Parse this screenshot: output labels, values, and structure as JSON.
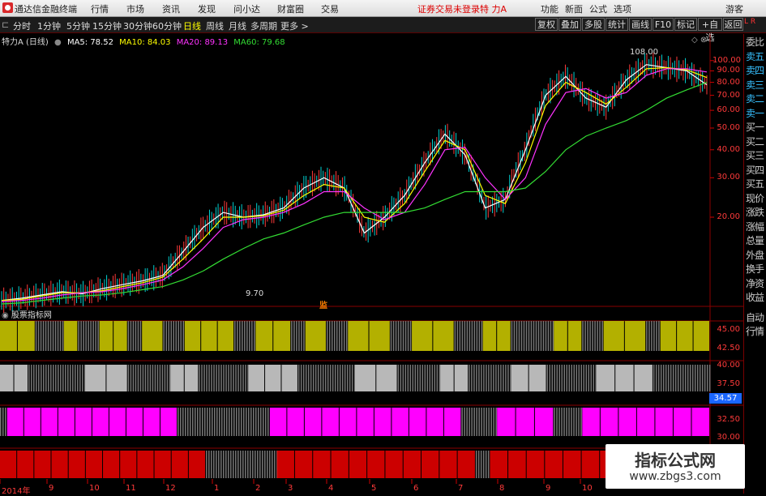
{
  "window": {
    "app_title": "通达信金融终端",
    "menus": [
      "行情",
      "市场",
      "资讯",
      "发现",
      "问小达",
      "财富圈",
      "交易"
    ],
    "notice": "证券交易未登录",
    "stock": "特 力A",
    "right_menus": [
      "功能",
      "新面",
      "公式",
      "选项"
    ],
    "user": "游客"
  },
  "toolbar": {
    "periods": [
      "分时",
      "1分钟",
      "5分钟",
      "15分钟",
      "30分钟",
      "60分钟",
      "日线",
      "周线",
      "月线",
      "多周期",
      "更多 >"
    ],
    "active": "日线",
    "right_buttons": [
      "复权",
      "叠加",
      "多股",
      "统计",
      "画线",
      "F10",
      "标记",
      "+自选",
      "返回"
    ]
  },
  "legend": {
    "name": "特力A (日线)",
    "ma5": "MA5: 78.52",
    "ma10": "MA10: 84.03",
    "ma20": "MA20: 89.13",
    "ma60": "MA60: 79.68",
    "colors": {
      "ma5": "#ffffff",
      "ma10": "#ffff00",
      "ma20": "#ff33ff",
      "ma60": "#33dd33"
    }
  },
  "price_annotations": {
    "high": "108.00",
    "low": "9.70",
    "marker": "监"
  },
  "side_panel": {
    "corner": "L R",
    "items": [
      "委比",
      "卖五",
      "卖四",
      "卖三",
      "卖二",
      "卖一",
      "买一",
      "买二",
      "买三",
      "买四",
      "买五",
      "现价",
      "涨跌",
      "涨幅",
      "总量",
      "外盘",
      "换手",
      "净资",
      "收益"
    ],
    "bottom_items": [
      "自动",
      "行情"
    ]
  },
  "indicator": {
    "title": "股票指标网",
    "value_badge": "34.57"
  },
  "watermark": {
    "line1": "指标公式网",
    "line2": "www.zbgs3.com"
  },
  "x_axis_labels": [
    "2014年",
    "9",
    "10",
    "11",
    "12",
    "1",
    "2",
    "3",
    "4",
    "5",
    "6",
    "7",
    "8",
    "9",
    "10"
  ],
  "chart_data": {
    "type": "line",
    "main_axis": {
      "scale": "log",
      "ticks": [
        100.0,
        90.0,
        80.0,
        70.0,
        60.0,
        50.0,
        40.0,
        30.0,
        20.0
      ]
    },
    "series": [
      {
        "name": "MA5",
        "values": [
          8.5,
          8.7,
          9.0,
          9.3,
          9.1,
          9.6,
          10,
          10.4,
          11,
          14,
          18,
          21,
          20,
          20.5,
          22,
          27,
          30,
          27,
          17,
          20,
          25,
          35,
          47,
          38,
          22,
          24,
          40,
          70,
          85,
          68,
          62,
          82,
          96,
          93,
          90,
          78
        ]
      },
      {
        "name": "MA10",
        "values": [
          8.5,
          8.6,
          8.9,
          9.2,
          9.2,
          9.4,
          9.8,
          10.2,
          10.8,
          13,
          16,
          20,
          20,
          20.3,
          21.5,
          25,
          28,
          27,
          20,
          19,
          23,
          32,
          44,
          40,
          25,
          23,
          35,
          63,
          80,
          72,
          64,
          76,
          92,
          93,
          91,
          84
        ]
      },
      {
        "name": "MA20",
        "values": [
          8.4,
          8.5,
          8.7,
          9.0,
          9.2,
          9.3,
          9.6,
          10,
          10.5,
          12,
          14.5,
          18,
          19.5,
          20,
          21,
          23,
          26,
          26,
          22,
          19.5,
          21,
          28,
          40,
          41,
          30,
          24,
          30,
          52,
          72,
          75,
          68,
          72,
          86,
          92,
          92,
          89
        ]
      },
      {
        "name": "MA60",
        "values": [
          8.2,
          8.3,
          8.5,
          8.7,
          8.9,
          9.0,
          9.2,
          9.5,
          9.8,
          10.5,
          11.5,
          13,
          14.5,
          16,
          17,
          18.5,
          20,
          21,
          21,
          21,
          21,
          22,
          24,
          26,
          26,
          26,
          27,
          32,
          40,
          46,
          50,
          54,
          60,
          68,
          74,
          80
        ]
      }
    ],
    "indicator_axes": [
      {
        "ticks": [
          45.0,
          42.5
        ]
      },
      {
        "ticks": [
          40.0,
          37.5
        ]
      },
      {
        "ticks": [
          32.5,
          30.0
        ]
      }
    ],
    "bands": [
      {
        "color": "#b3b000",
        "segments": [
          [
            0,
            0.05,
            1
          ],
          [
            0.05,
            0.09,
            0
          ],
          [
            0.09,
            0.11,
            1
          ],
          [
            0.11,
            0.14,
            0
          ],
          [
            0.14,
            0.18,
            1
          ],
          [
            0.18,
            0.2,
            0
          ],
          [
            0.2,
            0.23,
            1
          ],
          [
            0.23,
            0.26,
            0
          ],
          [
            0.26,
            0.33,
            1
          ],
          [
            0.33,
            0.36,
            0
          ],
          [
            0.36,
            0.41,
            1
          ],
          [
            0.41,
            0.43,
            0
          ],
          [
            0.43,
            0.46,
            1
          ],
          [
            0.46,
            0.49,
            0
          ],
          [
            0.49,
            0.55,
            1
          ],
          [
            0.55,
            0.58,
            0
          ],
          [
            0.58,
            0.64,
            1
          ],
          [
            0.64,
            0.68,
            0
          ],
          [
            0.68,
            0.72,
            1
          ],
          [
            0.72,
            0.78,
            0
          ],
          [
            0.78,
            0.82,
            1
          ],
          [
            0.82,
            0.85,
            0
          ],
          [
            0.85,
            0.91,
            1
          ],
          [
            0.91,
            0.93,
            0
          ],
          [
            0.93,
            1,
            1
          ]
        ]
      },
      {
        "color": "#b8b8b8",
        "segments": [
          [
            0,
            0.04,
            1
          ],
          [
            0.04,
            0.12,
            0
          ],
          [
            0.12,
            0.18,
            1
          ],
          [
            0.18,
            0.24,
            0
          ],
          [
            0.24,
            0.28,
            1
          ],
          [
            0.28,
            0.35,
            0
          ],
          [
            0.35,
            0.42,
            1
          ],
          [
            0.42,
            0.5,
            0
          ],
          [
            0.5,
            0.56,
            1
          ],
          [
            0.56,
            0.62,
            0
          ],
          [
            0.62,
            0.66,
            1
          ],
          [
            0.66,
            0.72,
            0
          ],
          [
            0.72,
            0.77,
            1
          ],
          [
            0.77,
            0.84,
            0
          ],
          [
            0.84,
            0.92,
            1
          ],
          [
            0.92,
            1,
            0
          ]
        ]
      },
      {
        "color": "#ff00ff",
        "segments": [
          [
            0,
            0.01,
            0
          ],
          [
            0.01,
            0.25,
            1
          ],
          [
            0.25,
            0.38,
            0
          ],
          [
            0.38,
            0.65,
            1
          ],
          [
            0.65,
            0.7,
            0
          ],
          [
            0.7,
            0.78,
            1
          ],
          [
            0.78,
            0.82,
            0
          ],
          [
            0.82,
            1,
            1
          ]
        ]
      },
      {
        "color": "#cc0000",
        "segments": [
          [
            0,
            0.29,
            1
          ],
          [
            0.29,
            0.39,
            0
          ],
          [
            0.39,
            0.67,
            1
          ],
          [
            0.67,
            0.69,
            0
          ],
          [
            0.69,
            1,
            1
          ]
        ]
      }
    ]
  }
}
